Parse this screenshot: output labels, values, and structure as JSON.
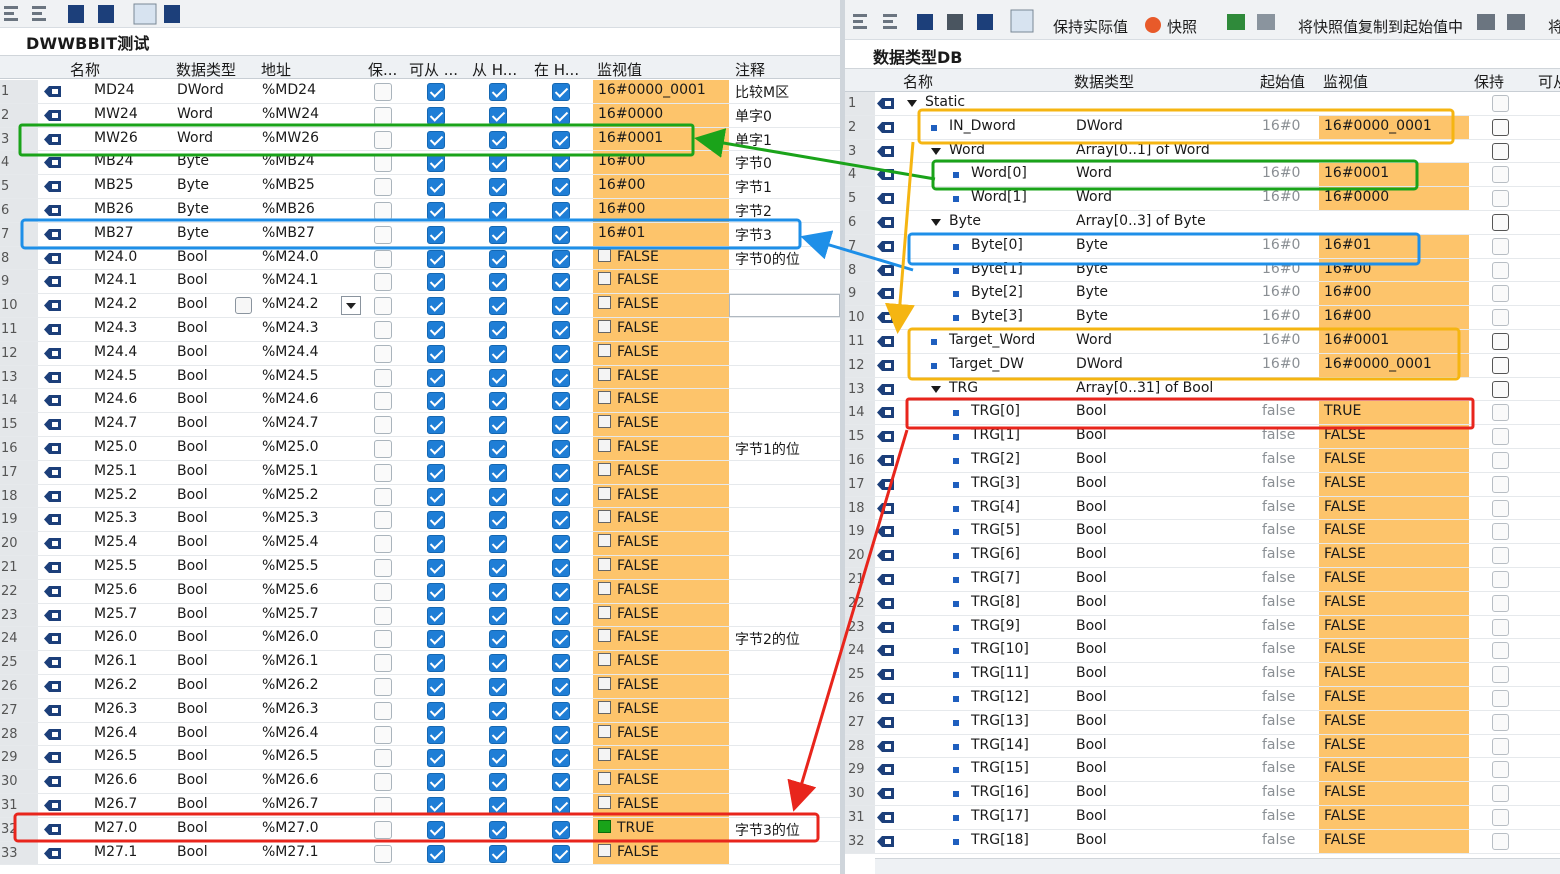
{
  "left": {
    "title": "DWWBBIT测试",
    "headers": [
      "名称",
      "数据类型",
      "地址",
      "保...",
      "可从 ...",
      "从 H...",
      "在 H...",
      "监视值",
      "注释"
    ],
    "rows": [
      {
        "n": "1",
        "name": "MD24",
        "type": "DWord",
        "addr": "%MD24",
        "val": "16#0000_0001",
        "bool": false,
        "cmt": "比较M区"
      },
      {
        "n": "2",
        "name": "MW24",
        "type": "Word",
        "addr": "%MW24",
        "val": "16#0000",
        "bool": false,
        "cmt": "单字0"
      },
      {
        "n": "3",
        "name": "MW26",
        "type": "Word",
        "addr": "%MW26",
        "val": "16#0001",
        "bool": false,
        "cmt": "单字1"
      },
      {
        "n": "4",
        "name": "MB24",
        "type": "Byte",
        "addr": "%MB24",
        "val": "16#00",
        "bool": false,
        "cmt": "字节0"
      },
      {
        "n": "5",
        "name": "MB25",
        "type": "Byte",
        "addr": "%MB25",
        "val": "16#00",
        "bool": false,
        "cmt": "字节1"
      },
      {
        "n": "6",
        "name": "MB26",
        "type": "Byte",
        "addr": "%MB26",
        "val": "16#00",
        "bool": false,
        "cmt": "字节2"
      },
      {
        "n": "7",
        "name": "MB27",
        "type": "Byte",
        "addr": "%MB27",
        "val": "16#01",
        "bool": false,
        "cmt": "字节3"
      },
      {
        "n": "8",
        "name": "M24.0",
        "type": "Bool",
        "addr": "%M24.0",
        "val": "FALSE",
        "bool": true,
        "on": false,
        "cmt": "字节0的位"
      },
      {
        "n": "9",
        "name": "M24.1",
        "type": "Bool",
        "addr": "%M24.1",
        "val": "FALSE",
        "bool": true,
        "on": false,
        "cmt": ""
      },
      {
        "n": "10",
        "name": "M24.2",
        "type": "Bool",
        "addr": "%M24.2",
        "val": "FALSE",
        "bool": true,
        "on": false,
        "cmt": ""
      },
      {
        "n": "11",
        "name": "M24.3",
        "type": "Bool",
        "addr": "%M24.3",
        "val": "FALSE",
        "bool": true,
        "on": false,
        "cmt": ""
      },
      {
        "n": "12",
        "name": "M24.4",
        "type": "Bool",
        "addr": "%M24.4",
        "val": "FALSE",
        "bool": true,
        "on": false,
        "cmt": ""
      },
      {
        "n": "13",
        "name": "M24.5",
        "type": "Bool",
        "addr": "%M24.5",
        "val": "FALSE",
        "bool": true,
        "on": false,
        "cmt": ""
      },
      {
        "n": "14",
        "name": "M24.6",
        "type": "Bool",
        "addr": "%M24.6",
        "val": "FALSE",
        "bool": true,
        "on": false,
        "cmt": ""
      },
      {
        "n": "15",
        "name": "M24.7",
        "type": "Bool",
        "addr": "%M24.7",
        "val": "FALSE",
        "bool": true,
        "on": false,
        "cmt": ""
      },
      {
        "n": "16",
        "name": "M25.0",
        "type": "Bool",
        "addr": "%M25.0",
        "val": "FALSE",
        "bool": true,
        "on": false,
        "cmt": "字节1的位"
      },
      {
        "n": "17",
        "name": "M25.1",
        "type": "Bool",
        "addr": "%M25.1",
        "val": "FALSE",
        "bool": true,
        "on": false,
        "cmt": ""
      },
      {
        "n": "18",
        "name": "M25.2",
        "type": "Bool",
        "addr": "%M25.2",
        "val": "FALSE",
        "bool": true,
        "on": false,
        "cmt": ""
      },
      {
        "n": "19",
        "name": "M25.3",
        "type": "Bool",
        "addr": "%M25.3",
        "val": "FALSE",
        "bool": true,
        "on": false,
        "cmt": ""
      },
      {
        "n": "20",
        "name": "M25.4",
        "type": "Bool",
        "addr": "%M25.4",
        "val": "FALSE",
        "bool": true,
        "on": false,
        "cmt": ""
      },
      {
        "n": "21",
        "name": "M25.5",
        "type": "Bool",
        "addr": "%M25.5",
        "val": "FALSE",
        "bool": true,
        "on": false,
        "cmt": ""
      },
      {
        "n": "22",
        "name": "M25.6",
        "type": "Bool",
        "addr": "%M25.6",
        "val": "FALSE",
        "bool": true,
        "on": false,
        "cmt": ""
      },
      {
        "n": "23",
        "name": "M25.7",
        "type": "Bool",
        "addr": "%M25.7",
        "val": "FALSE",
        "bool": true,
        "on": false,
        "cmt": ""
      },
      {
        "n": "24",
        "name": "M26.0",
        "type": "Bool",
        "addr": "%M26.0",
        "val": "FALSE",
        "bool": true,
        "on": false,
        "cmt": "字节2的位"
      },
      {
        "n": "25",
        "name": "M26.1",
        "type": "Bool",
        "addr": "%M26.1",
        "val": "FALSE",
        "bool": true,
        "on": false,
        "cmt": ""
      },
      {
        "n": "26",
        "name": "M26.2",
        "type": "Bool",
        "addr": "%M26.2",
        "val": "FALSE",
        "bool": true,
        "on": false,
        "cmt": ""
      },
      {
        "n": "27",
        "name": "M26.3",
        "type": "Bool",
        "addr": "%M26.3",
        "val": "FALSE",
        "bool": true,
        "on": false,
        "cmt": ""
      },
      {
        "n": "28",
        "name": "M26.4",
        "type": "Bool",
        "addr": "%M26.4",
        "val": "FALSE",
        "bool": true,
        "on": false,
        "cmt": ""
      },
      {
        "n": "29",
        "name": "M26.5",
        "type": "Bool",
        "addr": "%M26.5",
        "val": "FALSE",
        "bool": true,
        "on": false,
        "cmt": ""
      },
      {
        "n": "30",
        "name": "M26.6",
        "type": "Bool",
        "addr": "%M26.6",
        "val": "FALSE",
        "bool": true,
        "on": false,
        "cmt": ""
      },
      {
        "n": "31",
        "name": "M26.7",
        "type": "Bool",
        "addr": "%M26.7",
        "val": "FALSE",
        "bool": true,
        "on": false,
        "cmt": ""
      },
      {
        "n": "32",
        "name": "M27.0",
        "type": "Bool",
        "addr": "%M27.0",
        "val": "TRUE",
        "bool": true,
        "on": true,
        "cmt": "字节3的位"
      },
      {
        "n": "33",
        "name": "M27.1",
        "type": "Bool",
        "addr": "%M27.1",
        "val": "FALSE",
        "bool": true,
        "on": false,
        "cmt": ""
      }
    ]
  },
  "right": {
    "toolbar": {
      "keep_actual": "保持实际值",
      "snapshot": "快照",
      "copy_snapshot": "将快照值复制到起始值中",
      "more": "将"
    },
    "title": "数据类型DB",
    "headers": [
      "名称",
      "数据类型",
      "起始值",
      "监视值",
      "保持",
      "可从"
    ],
    "rows": [
      {
        "n": "1",
        "name": "Static",
        "type": "",
        "start": "",
        "val": "",
        "lvl": 0,
        "expand": true,
        "keep": false
      },
      {
        "n": "2",
        "name": "IN_Dword",
        "type": "DWord",
        "start": "16#0",
        "val": "16#0000_0001",
        "lvl": 1,
        "keep": true
      },
      {
        "n": "3",
        "name": "Word",
        "type": "Array[0..1] of Word",
        "start": "",
        "val": "",
        "lvl": 1,
        "expand": true,
        "keep": true
      },
      {
        "n": "4",
        "name": "Word[0]",
        "type": "Word",
        "start": "16#0",
        "val": "16#0001",
        "lvl": 2,
        "keep": false
      },
      {
        "n": "5",
        "name": "Word[1]",
        "type": "Word",
        "start": "16#0",
        "val": "16#0000",
        "lvl": 2,
        "keep": false
      },
      {
        "n": "6",
        "name": "Byte",
        "type": "Array[0..3] of Byte",
        "start": "",
        "val": "",
        "lvl": 1,
        "expand": true,
        "keep": true
      },
      {
        "n": "7",
        "name": "Byte[0]",
        "type": "Byte",
        "start": "16#0",
        "val": "16#01",
        "lvl": 2,
        "keep": false
      },
      {
        "n": "8",
        "name": "Byte[1]",
        "type": "Byte",
        "start": "16#0",
        "val": "16#00",
        "lvl": 2,
        "keep": false
      },
      {
        "n": "9",
        "name": "Byte[2]",
        "type": "Byte",
        "start": "16#0",
        "val": "16#00",
        "lvl": 2,
        "keep": false
      },
      {
        "n": "10",
        "name": "Byte[3]",
        "type": "Byte",
        "start": "16#0",
        "val": "16#00",
        "lvl": 2,
        "keep": false
      },
      {
        "n": "11",
        "name": "Target_Word",
        "type": "Word",
        "start": "16#0",
        "val": "16#0001",
        "lvl": 1,
        "keep": true
      },
      {
        "n": "12",
        "name": "Target_DW",
        "type": "DWord",
        "start": "16#0",
        "val": "16#0000_0001",
        "lvl": 1,
        "keep": true
      },
      {
        "n": "13",
        "name": "TRG",
        "type": "Array[0..31] of Bool",
        "start": "",
        "val": "",
        "lvl": 1,
        "expand": true,
        "keep": true
      },
      {
        "n": "14",
        "name": "TRG[0]",
        "type": "Bool",
        "start": "false",
        "val": "TRUE",
        "lvl": 2,
        "keep": false
      },
      {
        "n": "15",
        "name": "TRG[1]",
        "type": "Bool",
        "start": "false",
        "val": "FALSE",
        "lvl": 2,
        "keep": false
      },
      {
        "n": "16",
        "name": "TRG[2]",
        "type": "Bool",
        "start": "false",
        "val": "FALSE",
        "lvl": 2,
        "keep": false
      },
      {
        "n": "17",
        "name": "TRG[3]",
        "type": "Bool",
        "start": "false",
        "val": "FALSE",
        "lvl": 2,
        "keep": false
      },
      {
        "n": "18",
        "name": "TRG[4]",
        "type": "Bool",
        "start": "false",
        "val": "FALSE",
        "lvl": 2,
        "keep": false
      },
      {
        "n": "19",
        "name": "TRG[5]",
        "type": "Bool",
        "start": "false",
        "val": "FALSE",
        "lvl": 2,
        "keep": false
      },
      {
        "n": "20",
        "name": "TRG[6]",
        "type": "Bool",
        "start": "false",
        "val": "FALSE",
        "lvl": 2,
        "keep": false
      },
      {
        "n": "21",
        "name": "TRG[7]",
        "type": "Bool",
        "start": "false",
        "val": "FALSE",
        "lvl": 2,
        "keep": false
      },
      {
        "n": "22",
        "name": "TRG[8]",
        "type": "Bool",
        "start": "false",
        "val": "FALSE",
        "lvl": 2,
        "keep": false
      },
      {
        "n": "23",
        "name": "TRG[9]",
        "type": "Bool",
        "start": "false",
        "val": "FALSE",
        "lvl": 2,
        "keep": false
      },
      {
        "n": "24",
        "name": "TRG[10]",
        "type": "Bool",
        "start": "false",
        "val": "FALSE",
        "lvl": 2,
        "keep": false
      },
      {
        "n": "25",
        "name": "TRG[11]",
        "type": "Bool",
        "start": "false",
        "val": "FALSE",
        "lvl": 2,
        "keep": false
      },
      {
        "n": "26",
        "name": "TRG[12]",
        "type": "Bool",
        "start": "false",
        "val": "FALSE",
        "lvl": 2,
        "keep": false
      },
      {
        "n": "27",
        "name": "TRG[13]",
        "type": "Bool",
        "start": "false",
        "val": "FALSE",
        "lvl": 2,
        "keep": false
      },
      {
        "n": "28",
        "name": "TRG[14]",
        "type": "Bool",
        "start": "false",
        "val": "FALSE",
        "lvl": 2,
        "keep": false
      },
      {
        "n": "29",
        "name": "TRG[15]",
        "type": "Bool",
        "start": "false",
        "val": "FALSE",
        "lvl": 2,
        "keep": false
      },
      {
        "n": "30",
        "name": "TRG[16]",
        "type": "Bool",
        "start": "false",
        "val": "FALSE",
        "lvl": 2,
        "keep": false
      },
      {
        "n": "31",
        "name": "TRG[17]",
        "type": "Bool",
        "start": "false",
        "val": "FALSE",
        "lvl": 2,
        "keep": false
      },
      {
        "n": "32",
        "name": "TRG[18]",
        "type": "Bool",
        "start": "false",
        "val": "FALSE",
        "lvl": 2,
        "keep": false
      }
    ]
  },
  "colors": {
    "monitor_bg": "#fdc46b",
    "green_box": "#1aa31a",
    "blue_box": "#1e8fe8",
    "orange_box": "#f5b512",
    "red_box": "#e8251c",
    "checkbox_blue": "#1f7ed6"
  },
  "icons": [
    "tag-icon",
    "checkbox-icon",
    "expand-triangle-icon",
    "toolbar-icons"
  ]
}
